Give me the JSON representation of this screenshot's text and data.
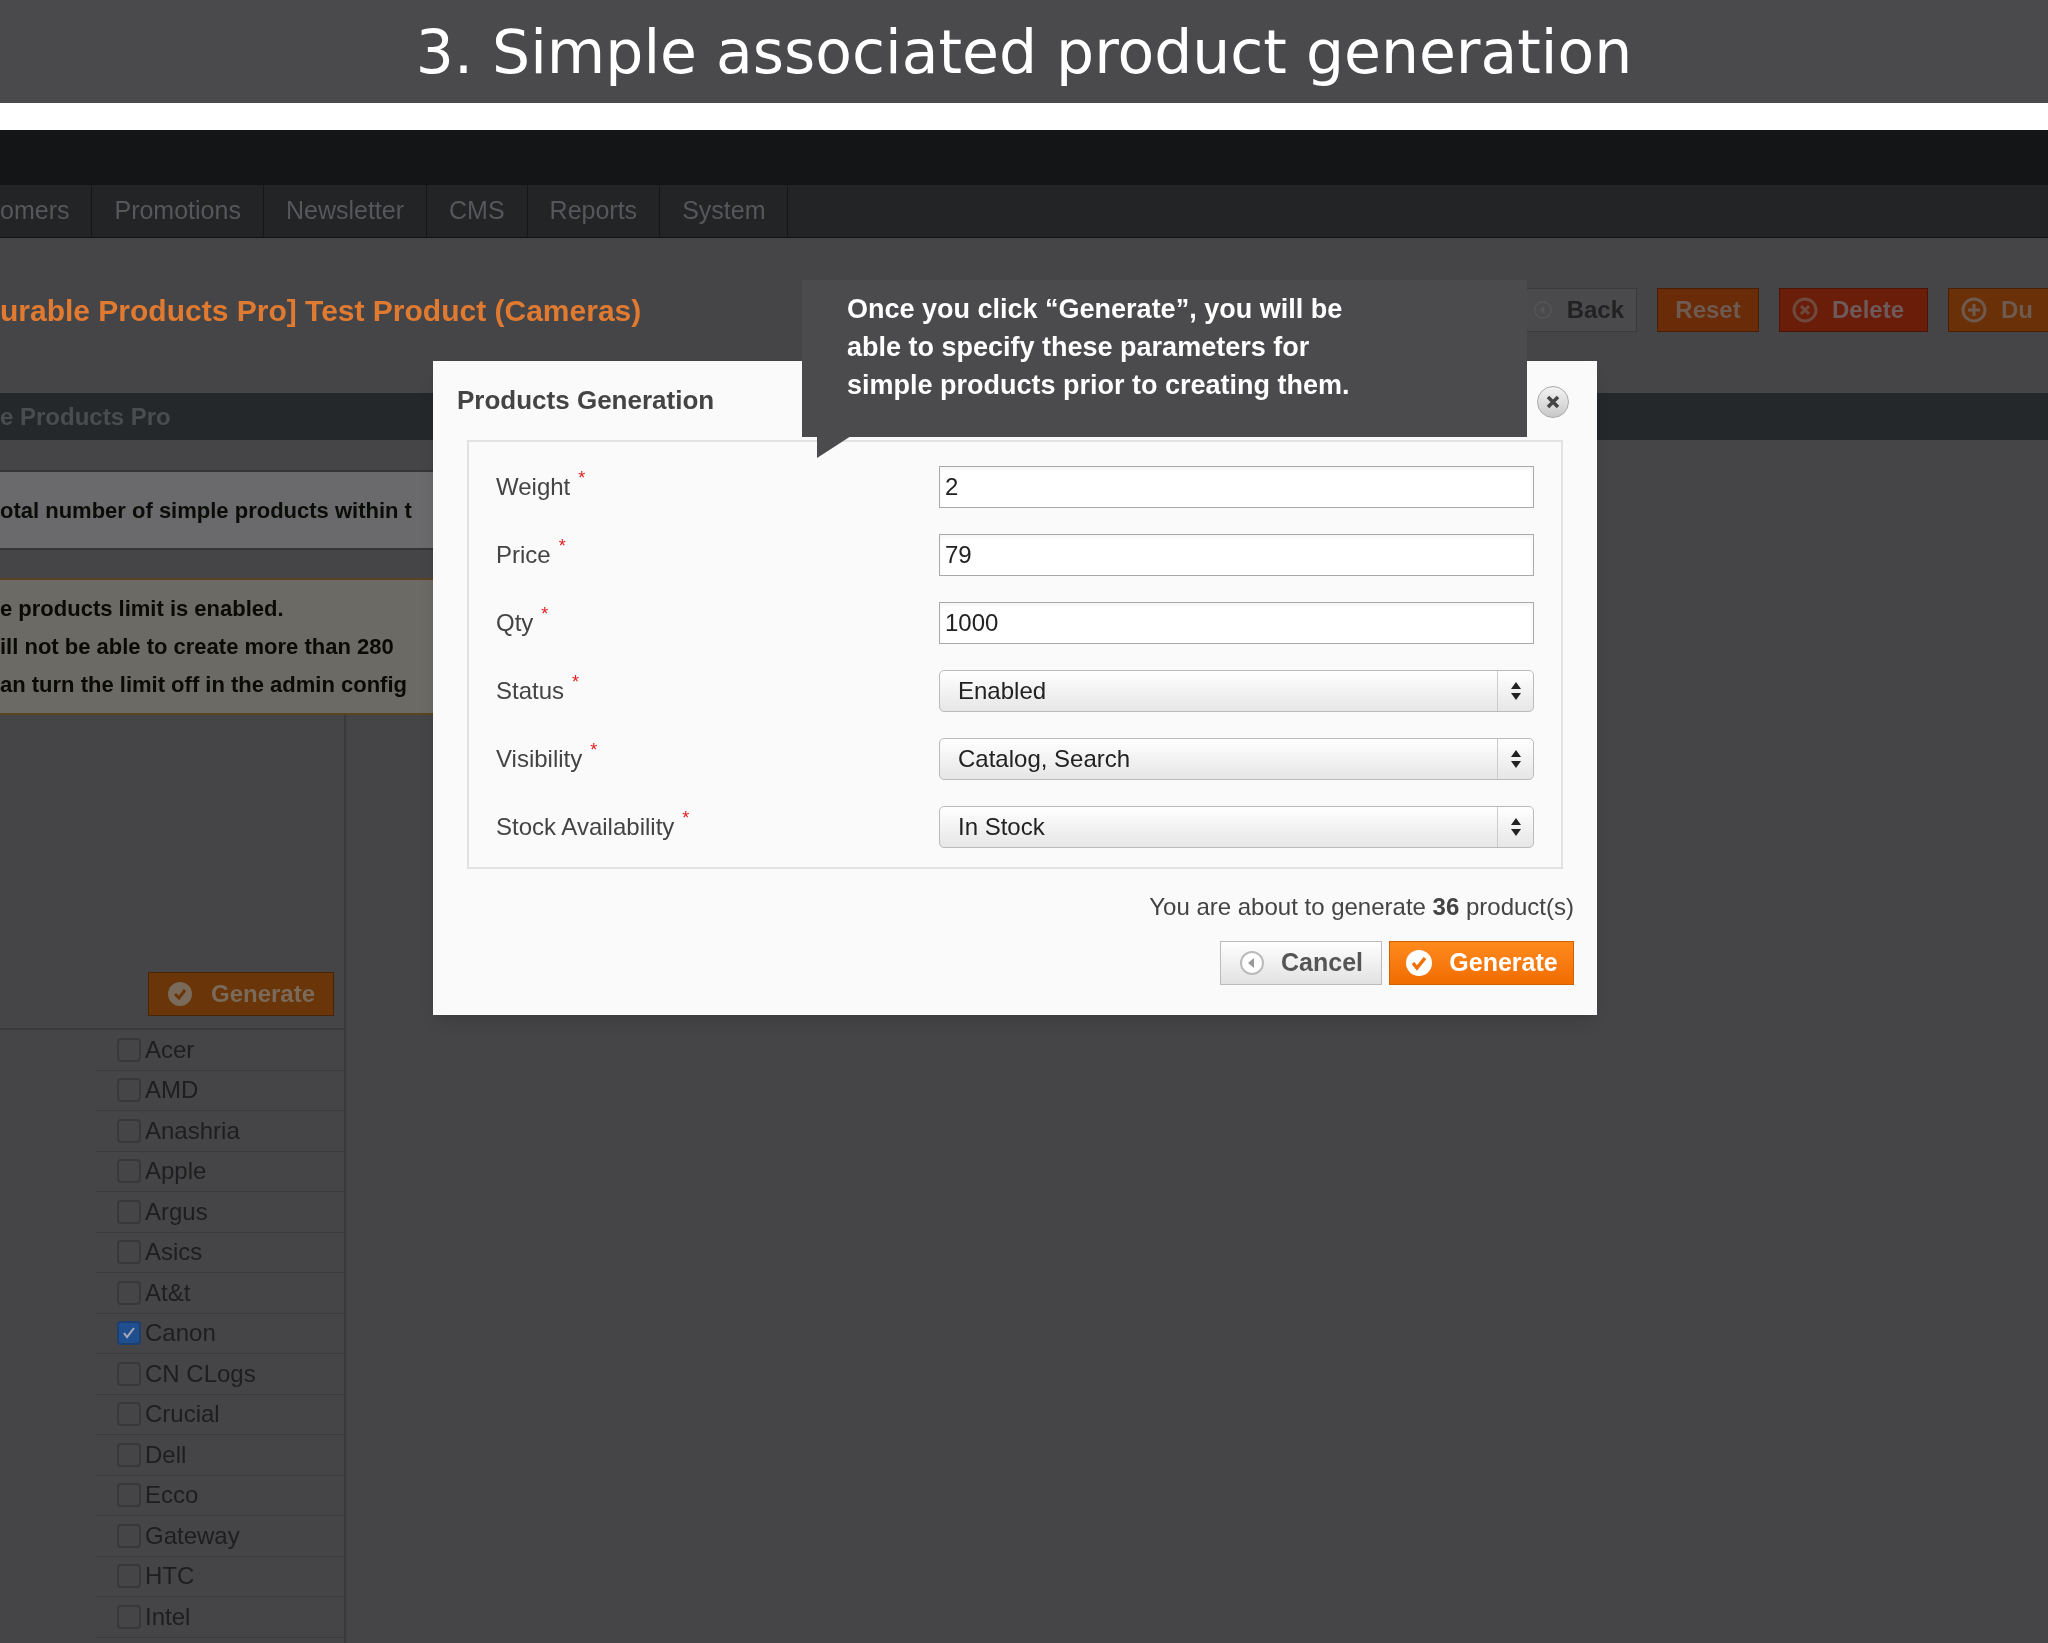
{
  "banner": {
    "title": "3. Simple associated product generation"
  },
  "nav": {
    "items": [
      "omers",
      "Promotions",
      "Newsletter",
      "CMS",
      "Reports",
      "System"
    ]
  },
  "page": {
    "title": "urable Products Pro] Test Product (Cameras)",
    "actions": [
      {
        "label": "Back",
        "kind": "back"
      },
      {
        "label": "Reset",
        "kind": "reset"
      },
      {
        "label": "Delete",
        "kind": "delete"
      },
      {
        "label": "Du",
        "kind": "duplicate"
      }
    ],
    "section_title": "e Products Pro",
    "note": "otal number of simple products within t",
    "warning_lines": [
      "e products limit is enabled.",
      "ill not be able to create more than 280",
      "an turn the limit off in the admin config"
    ],
    "generate_button": "Generate",
    "brands": [
      {
        "label": "Acer",
        "checked": false
      },
      {
        "label": "AMD",
        "checked": false
      },
      {
        "label": "Anashria",
        "checked": false
      },
      {
        "label": "Apple",
        "checked": false
      },
      {
        "label": "Argus",
        "checked": false
      },
      {
        "label": "Asics",
        "checked": false
      },
      {
        "label": "At&t",
        "checked": false
      },
      {
        "label": "Canon",
        "checked": true
      },
      {
        "label": "CN CLogs",
        "checked": false
      },
      {
        "label": "Crucial",
        "checked": false
      },
      {
        "label": "Dell",
        "checked": false
      },
      {
        "label": "Ecco",
        "checked": false
      },
      {
        "label": "Gateway",
        "checked": false
      },
      {
        "label": "HTC",
        "checked": false
      },
      {
        "label": "Intel",
        "checked": false
      }
    ]
  },
  "dialog": {
    "title": "Products Generation",
    "fields": [
      {
        "label": "Weight",
        "required_mark": "*",
        "kind": "text",
        "value": "2"
      },
      {
        "label": "Price",
        "required_mark": "*",
        "kind": "text",
        "value": "79"
      },
      {
        "label": "Qty",
        "required_mark": "*",
        "kind": "text",
        "value": "1000"
      },
      {
        "label": "Status",
        "required_mark": "*",
        "kind": "select",
        "value": "Enabled"
      },
      {
        "label": "Visibility",
        "required_mark": "*",
        "kind": "select",
        "value": "Catalog, Search"
      },
      {
        "label": "Stock Availability",
        "required_mark": "*",
        "kind": "select",
        "value": "In Stock"
      }
    ],
    "summary": "You are about to generate **36** product(s)",
    "buttons": [
      {
        "label": "Cancel",
        "kind": "cancel"
      },
      {
        "label": "Generate",
        "kind": "generate"
      }
    ]
  },
  "tooltip": {
    "lines": [
      "Once you click “Generate”, you will be",
      "able to specify these parameters for",
      "simple products prior to creating them."
    ]
  }
}
